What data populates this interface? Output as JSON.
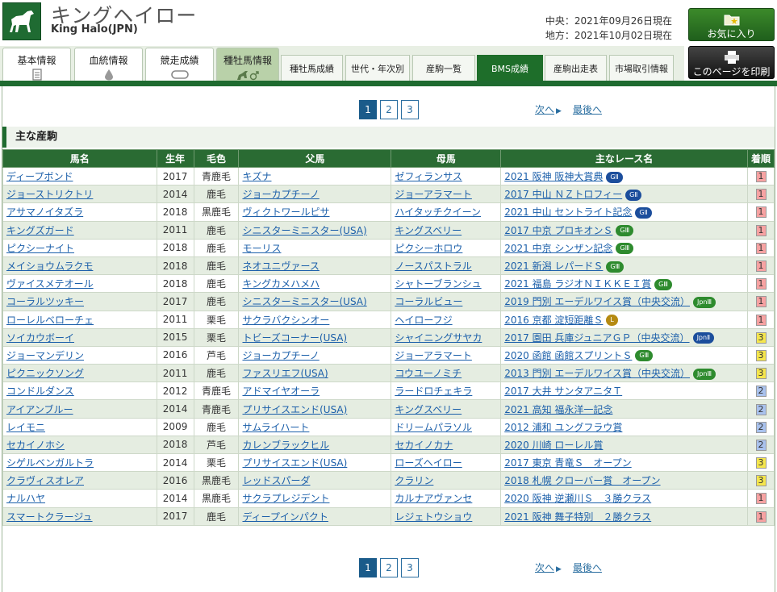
{
  "header": {
    "title_jp": "キングヘイロー",
    "title_en": "King Halo(JPN)",
    "date_central": "中央：2021年09月26日現在",
    "date_local": "地方：2021年10月02日現在",
    "favorite_label": "お気に入り",
    "print_label": "このページを印刷"
  },
  "main_tabs": [
    {
      "label": "基本情報",
      "icon": "document-icon"
    },
    {
      "label": "血統情報",
      "icon": "drop-icon"
    },
    {
      "label": "競走成績",
      "icon": "horseshoe-icon"
    },
    {
      "label": "種牡馬情報",
      "icon": "horse-male-icon"
    }
  ],
  "sub_tabs": [
    "種牡馬成績",
    "世代・年次別",
    "産駒一覧",
    "BMS成績",
    "産駒出走表",
    "市場取引情報"
  ],
  "pager": {
    "pages": [
      "1",
      "2",
      "3"
    ],
    "next": "次へ",
    "last": "最後へ"
  },
  "section_title": "主な産駒",
  "table": {
    "headers": [
      "馬名",
      "生年",
      "毛色",
      "父馬",
      "母馬",
      "主なレース名",
      "着順"
    ],
    "rows": [
      {
        "name": "ディープボンド",
        "year": "2017",
        "color": "青鹿毛",
        "sire": "キズナ",
        "dam": "ゼフィランサス",
        "race": "2021 阪神 阪神大賞典",
        "grade": "GⅡ",
        "grade_type": "g2",
        "rank": "1"
      },
      {
        "name": "ジョーストリクトリ",
        "year": "2014",
        "color": "鹿毛",
        "sire": "ジョーカプチーノ",
        "dam": "ジョーアラマート",
        "race": "2017 中山 ＮＺトロフィー",
        "grade": "GⅡ",
        "grade_type": "g2",
        "rank": "1"
      },
      {
        "name": "アサマノイタズラ",
        "year": "2018",
        "color": "黒鹿毛",
        "sire": "ヴィクトワールピサ",
        "dam": "ハイタッチクイーン",
        "race": "2021 中山 セントライト記念",
        "grade": "GⅡ",
        "grade_type": "g2",
        "rank": "1"
      },
      {
        "name": "キングズガード",
        "year": "2011",
        "color": "鹿毛",
        "sire": "シニスターミニスター(USA)",
        "dam": "キングスベリー",
        "race": "2017 中京 プロキオンＳ",
        "grade": "GⅢ",
        "grade_type": "g3",
        "rank": "1"
      },
      {
        "name": "ピクシーナイト",
        "year": "2018",
        "color": "鹿毛",
        "sire": "モーリス",
        "dam": "ピクシーホロウ",
        "race": "2021 中京 シンザン記念",
        "grade": "GⅢ",
        "grade_type": "g3",
        "rank": "1"
      },
      {
        "name": "メイショウムラクモ",
        "year": "2018",
        "color": "鹿毛",
        "sire": "ネオユニヴァース",
        "dam": "ノースパストラル",
        "race": "2021 新潟 レパードＳ",
        "grade": "GⅢ",
        "grade_type": "g3",
        "rank": "1"
      },
      {
        "name": "ヴァイスメテオール",
        "year": "2018",
        "color": "鹿毛",
        "sire": "キングカメハメハ",
        "dam": "シャトーブランシュ",
        "race": "2021 福島 ラジオＮＩＫＫＥＩ賞",
        "grade": "GⅢ",
        "grade_type": "g3",
        "rank": "1"
      },
      {
        "name": "コーラルツッキー",
        "year": "2017",
        "color": "鹿毛",
        "sire": "シニスターミニスター(USA)",
        "dam": "コーラルビュー",
        "race": "2019 門別 エーデルワイス賞（中央交流）",
        "grade": "JpnⅢ",
        "grade_type": "jpn3",
        "rank": "1"
      },
      {
        "name": "ローレルベローチェ",
        "year": "2011",
        "color": "栗毛",
        "sire": "サクラバクシンオー",
        "dam": "ヘイローフジ",
        "race": "2016 京都 淀短距離Ｓ",
        "grade": "L",
        "grade_type": "l",
        "rank": "1"
      },
      {
        "name": "ソイカウボーイ",
        "year": "2015",
        "color": "栗毛",
        "sire": "トビーズコーナー(USA)",
        "dam": "シャイニングサヤカ",
        "race": "2017 園田 兵庫ジュニアＧＰ（中央交流）",
        "grade": "JpnⅡ",
        "grade_type": "jpn2",
        "rank": "3"
      },
      {
        "name": "ジョーマンデリン",
        "year": "2016",
        "color": "芦毛",
        "sire": "ジョーカプチーノ",
        "dam": "ジョーアラマート",
        "race": "2020 函館 函館スプリントＳ",
        "grade": "GⅢ",
        "grade_type": "g3",
        "rank": "3"
      },
      {
        "name": "ピクニックソング",
        "year": "2011",
        "color": "鹿毛",
        "sire": "ファスリエフ(USA)",
        "dam": "コウユーノミチ",
        "race": "2013 門別 エーデルワイス賞（中央交流）",
        "grade": "JpnⅢ",
        "grade_type": "jpn3",
        "rank": "3"
      },
      {
        "name": "コンドルダンス",
        "year": "2012",
        "color": "青鹿毛",
        "sire": "アドマイヤオーラ",
        "dam": "ラードロチェキラ",
        "race": "2017 大井 サンタアニタＴ",
        "grade": "",
        "grade_type": "",
        "rank": "2"
      },
      {
        "name": "アイアンブルー",
        "year": "2014",
        "color": "青鹿毛",
        "sire": "プリサイスエンド(USA)",
        "dam": "キングスベリー",
        "race": "2021 高知 福永洋一記念",
        "grade": "",
        "grade_type": "",
        "rank": "2"
      },
      {
        "name": "レイモニ",
        "year": "2009",
        "color": "鹿毛",
        "sire": "サムライハート",
        "dam": "ドリームパラソル",
        "race": "2012 浦和 ユングフラウ賞",
        "grade": "",
        "grade_type": "",
        "rank": "2"
      },
      {
        "name": "セカイノホシ",
        "year": "2018",
        "color": "芦毛",
        "sire": "カレンブラックヒル",
        "dam": "セカイノカナ",
        "race": "2020 川崎 ローレル賞",
        "grade": "",
        "grade_type": "",
        "rank": "2"
      },
      {
        "name": "シゲルベンガルトラ",
        "year": "2014",
        "color": "栗毛",
        "sire": "プリサイスエンド(USA)",
        "dam": "ローズヘイロー",
        "race": "2017 東京 青竜Ｓ　オープン",
        "grade": "",
        "grade_type": "",
        "rank": "3"
      },
      {
        "name": "クラヴィスオレア",
        "year": "2016",
        "color": "黒鹿毛",
        "sire": "レッドスパーダ",
        "dam": "クラリン",
        "race": "2018 札幌 クローバー賞　オープン",
        "grade": "",
        "grade_type": "",
        "rank": "3"
      },
      {
        "name": "ナルハヤ",
        "year": "2014",
        "color": "黒鹿毛",
        "sire": "サクラプレジデント",
        "dam": "カルナアヴァンセ",
        "race": "2020 阪神 逆瀬川Ｓ　３勝クラス",
        "grade": "",
        "grade_type": "",
        "rank": "1"
      },
      {
        "name": "スマートクラージュ",
        "year": "2017",
        "color": "鹿毛",
        "sire": "ディープインパクト",
        "dam": "レジェトウショウ",
        "race": "2021 阪神 舞子特別　２勝クラス",
        "grade": "",
        "grade_type": "",
        "rank": "1"
      }
    ]
  },
  "colors": {
    "brand_green": "#1f6b30",
    "link_blue": "#1b5faa",
    "rank1": "#f7a2a2",
    "rank2": "#a9c2ee",
    "rank3": "#f5e64d"
  }
}
